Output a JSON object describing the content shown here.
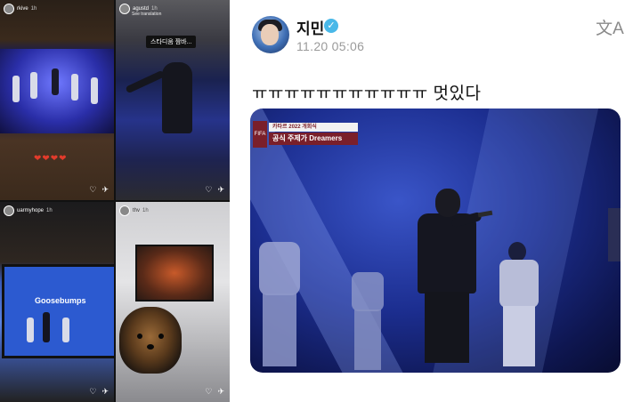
{
  "stories": [
    {
      "user": "rkive",
      "time": "1h",
      "subtitle": ""
    },
    {
      "user": "agustd",
      "time": "1h",
      "subtitle": "See translation",
      "caption": "스타디움 짬바..."
    },
    {
      "user": "uarmyhope",
      "time": "1h",
      "subtitle": "",
      "overlay_text": "Goosebumps"
    },
    {
      "user": "thv",
      "time": "1h",
      "subtitle": ""
    }
  ],
  "post": {
    "author": "지민",
    "verified_mark": "✓",
    "datetime": "11.20 05:06",
    "translate_icon": "translate-icon",
    "translate_glyph": "文A",
    "text": "ㅠㅠㅠㅠㅠㅠㅠㅠㅠㅠㅠ 멋있다",
    "photo": {
      "broadcast_logo": "FIFA",
      "broadcast_title": "카타르 2022 개회식",
      "broadcast_subtitle": "공식 주제가 Dreamers"
    }
  },
  "icons": {
    "heart": "♡",
    "send": "✈"
  },
  "colors": {
    "verified": "#49b8e8",
    "broadcast_brand": "#7a1f2a",
    "stage_blue": "#1c2e90"
  }
}
